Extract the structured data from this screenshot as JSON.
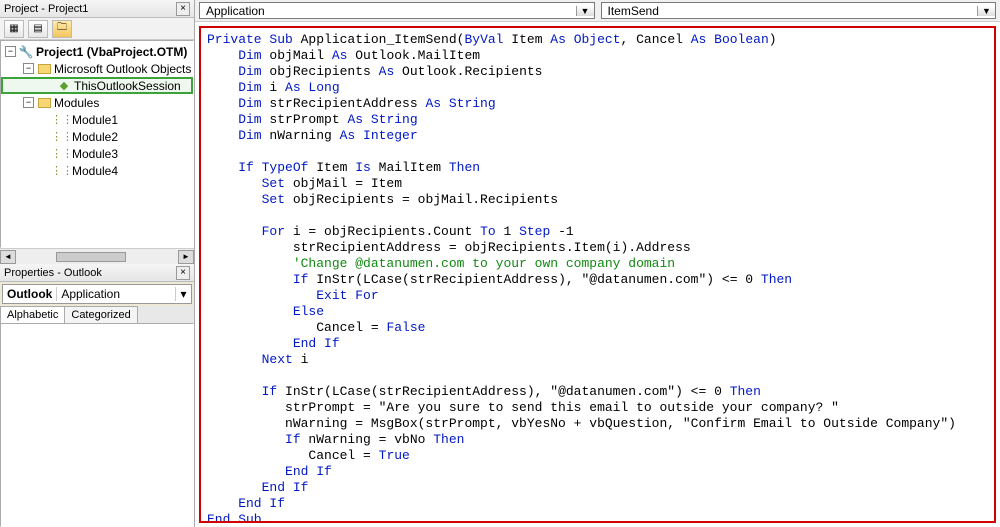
{
  "panels": {
    "project_title": "Project - Project1",
    "properties_title": "Properties - Outlook"
  },
  "project_tree": {
    "root": "Project1 (VbaProject.OTM)",
    "folder1": "Microsoft Outlook Objects",
    "item1": "ThisOutlookSession",
    "folder2": "Modules",
    "mod1": "Module1",
    "mod2": "Module2",
    "mod3": "Module3",
    "mod4": "Module4"
  },
  "properties": {
    "object_name": "Outlook",
    "object_type": "Application",
    "tab_alpha": "Alphabetic",
    "tab_cat": "Categorized"
  },
  "combos": {
    "object": "Application",
    "procedure": "ItemSend"
  },
  "code": {
    "l01a": "Private Sub",
    "l01b": " Application_ItemSend(",
    "l01c": "ByVal",
    "l01d": " Item ",
    "l01e": "As Object",
    "l01f": ", Cancel ",
    "l01g": "As Boolean",
    "l01h": ")",
    "l02a": "    Dim",
    "l02b": " objMail ",
    "l02c": "As",
    "l02d": " Outlook.MailItem",
    "l03a": "    Dim",
    "l03b": " objRecipients ",
    "l03c": "As",
    "l03d": " Outlook.Recipients",
    "l04a": "    Dim",
    "l04b": " i ",
    "l04c": "As Long",
    "l05a": "    Dim",
    "l05b": " strRecipientAddress ",
    "l05c": "As String",
    "l06a": "    Dim",
    "l06b": " strPrompt ",
    "l06c": "As String",
    "l07a": "    Dim",
    "l07b": " nWarning ",
    "l07c": "As Integer",
    "l09a": "    If TypeOf",
    "l09b": " Item ",
    "l09c": "Is",
    "l09d": " MailItem ",
    "l09e": "Then",
    "l10a": "       Set",
    "l10b": " objMail = Item",
    "l11a": "       Set",
    "l11b": " objRecipients = objMail.Recipients",
    "l13a": "       For",
    "l13b": " i = objRecipients.Count ",
    "l13c": "To",
    "l13d": " 1 ",
    "l13e": "Step",
    "l13f": " -1",
    "l14": "           strRecipientAddress = objRecipients.Item(i).Address",
    "l15": "           'Change @datanumen.com to your own company domain",
    "l16a": "           If",
    "l16b": " InStr(LCase(strRecipientAddress), \"@datanumen.com\") <= 0 ",
    "l16c": "Then",
    "l17": "              Exit For",
    "l18": "           Else",
    "l19a": "              Cancel = ",
    "l19b": "False",
    "l20": "           End If",
    "l21a": "       Next",
    "l21b": " i",
    "l23a": "       If",
    "l23b": " InStr(LCase(strRecipientAddress), \"@datanumen.com\") <= 0 ",
    "l23c": "Then",
    "l24": "          strPrompt = \"Are you sure to send this email to outside your company? \"",
    "l25": "          nWarning = MsgBox(strPrompt, vbYesNo + vbQuestion, \"Confirm Email to Outside Company\")",
    "l26a": "          If",
    "l26b": " nWarning = vbNo ",
    "l26c": "Then",
    "l27a": "             Cancel = ",
    "l27b": "True",
    "l28": "          End If",
    "l29": "       End If",
    "l30": "    End If",
    "l31": "End Sub"
  }
}
